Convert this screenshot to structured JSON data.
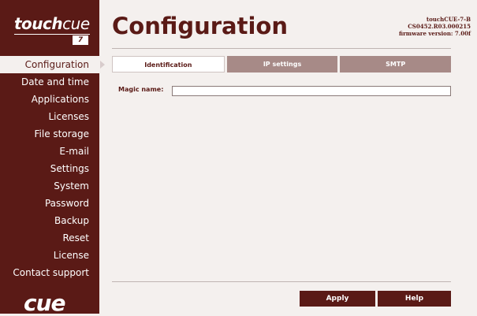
{
  "brand": {
    "logo_text_bold": "touch",
    "logo_text_light": "cue",
    "logo_badge": "7",
    "bottom_logo": "cue"
  },
  "device": {
    "model": "touchCUE-7-B",
    "serial": "CS0452.R03.000215",
    "firmware": "firmware version: 7.00f"
  },
  "page": {
    "title": "Configuration"
  },
  "sidebar": {
    "items": [
      {
        "label": "Configuration",
        "active": true
      },
      {
        "label": "Date and time"
      },
      {
        "label": "Applications"
      },
      {
        "label": "Licenses"
      },
      {
        "label": "File storage"
      },
      {
        "label": "E-mail"
      },
      {
        "label": "Settings"
      },
      {
        "label": "System"
      },
      {
        "label": "Password"
      },
      {
        "label": "Backup"
      },
      {
        "label": "Reset"
      },
      {
        "label": "License"
      },
      {
        "label": "Contact support"
      }
    ]
  },
  "tabs": [
    {
      "label": "Identification",
      "active": true
    },
    {
      "label": "IP settings"
    },
    {
      "label": "SMTP"
    }
  ],
  "form": {
    "magic_name_label": "Magic name:",
    "magic_name_value": ""
  },
  "buttons": {
    "apply": "Apply",
    "help": "Help"
  },
  "colors": {
    "brand": "#5a1a16",
    "tab_inactive": "#a78a87",
    "background": "#f4f0ee"
  }
}
